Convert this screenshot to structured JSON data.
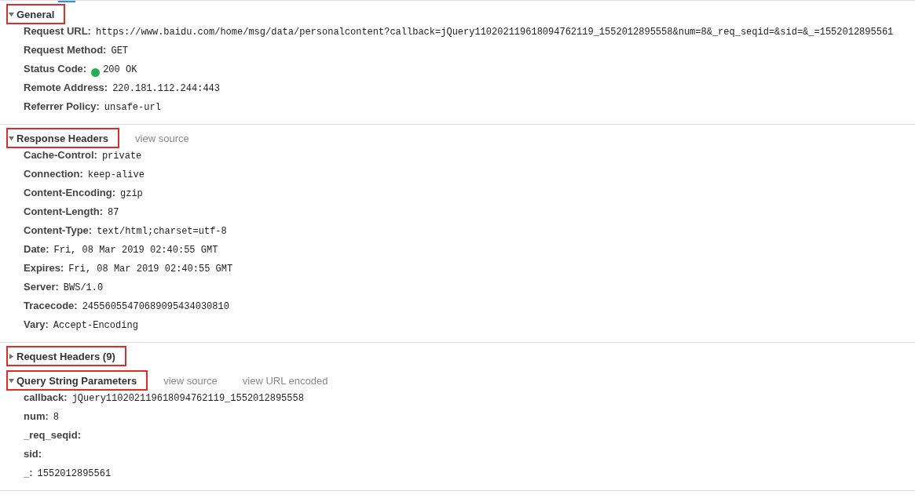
{
  "sections": [
    {
      "title": "General",
      "expanded": true,
      "highlighted": true,
      "rows": [
        {
          "kind": "text",
          "key": "Request URL:",
          "value": "https://www.baidu.com/home/msg/data/personalcontent?callback=jQuery110202119618094762119_1552012895558&num=8&_req_seqid=&sid=&_=1552012895561"
        },
        {
          "kind": "text",
          "key": "Request Method:",
          "value": "GET"
        },
        {
          "kind": "status",
          "key": "Status Code:",
          "value": "200 OK",
          "color": "#22b14c"
        },
        {
          "kind": "text",
          "key": "Remote Address:",
          "value": "220.181.112.244:443"
        },
        {
          "kind": "text",
          "key": "Referrer Policy:",
          "value": "unsafe-url"
        }
      ]
    },
    {
      "title": "Response Headers",
      "expanded": true,
      "highlighted": true,
      "links": [
        "view source"
      ],
      "rows": [
        {
          "kind": "text",
          "key": "Cache-Control:",
          "value": "private"
        },
        {
          "kind": "text",
          "key": "Connection:",
          "value": "keep-alive"
        },
        {
          "kind": "text",
          "key": "Content-Encoding:",
          "value": "gzip"
        },
        {
          "kind": "text",
          "key": "Content-Length:",
          "value": "87"
        },
        {
          "kind": "text",
          "key": "Content-Type:",
          "value": "text/html;charset=utf-8"
        },
        {
          "kind": "text",
          "key": "Date:",
          "value": "Fri, 08 Mar 2019 02:40:55 GMT"
        },
        {
          "kind": "text",
          "key": "Expires:",
          "value": "Fri, 08 Mar 2019 02:40:55 GMT"
        },
        {
          "kind": "text",
          "key": "Server:",
          "value": "BWS/1.0"
        },
        {
          "kind": "text",
          "key": "Tracecode:",
          "value": "24556055470689095434030810"
        },
        {
          "kind": "text",
          "key": "Vary:",
          "value": "Accept-Encoding"
        }
      ]
    },
    {
      "title": "Request Headers (9)",
      "expanded": false,
      "highlighted": true
    },
    {
      "title": "Query String Parameters",
      "expanded": true,
      "highlighted": true,
      "links": [
        "view source",
        "view URL encoded"
      ],
      "rows": [
        {
          "kind": "text",
          "key": "callback:",
          "value": "jQuery110202119618094762119_1552012895558"
        },
        {
          "kind": "text",
          "key": "num:",
          "value": "8"
        },
        {
          "kind": "text",
          "key": "_req_seqid:"
        },
        {
          "kind": "text",
          "key": "sid:"
        },
        {
          "kind": "text",
          "key": "_:",
          "value": "1552012895561"
        }
      ]
    }
  ]
}
